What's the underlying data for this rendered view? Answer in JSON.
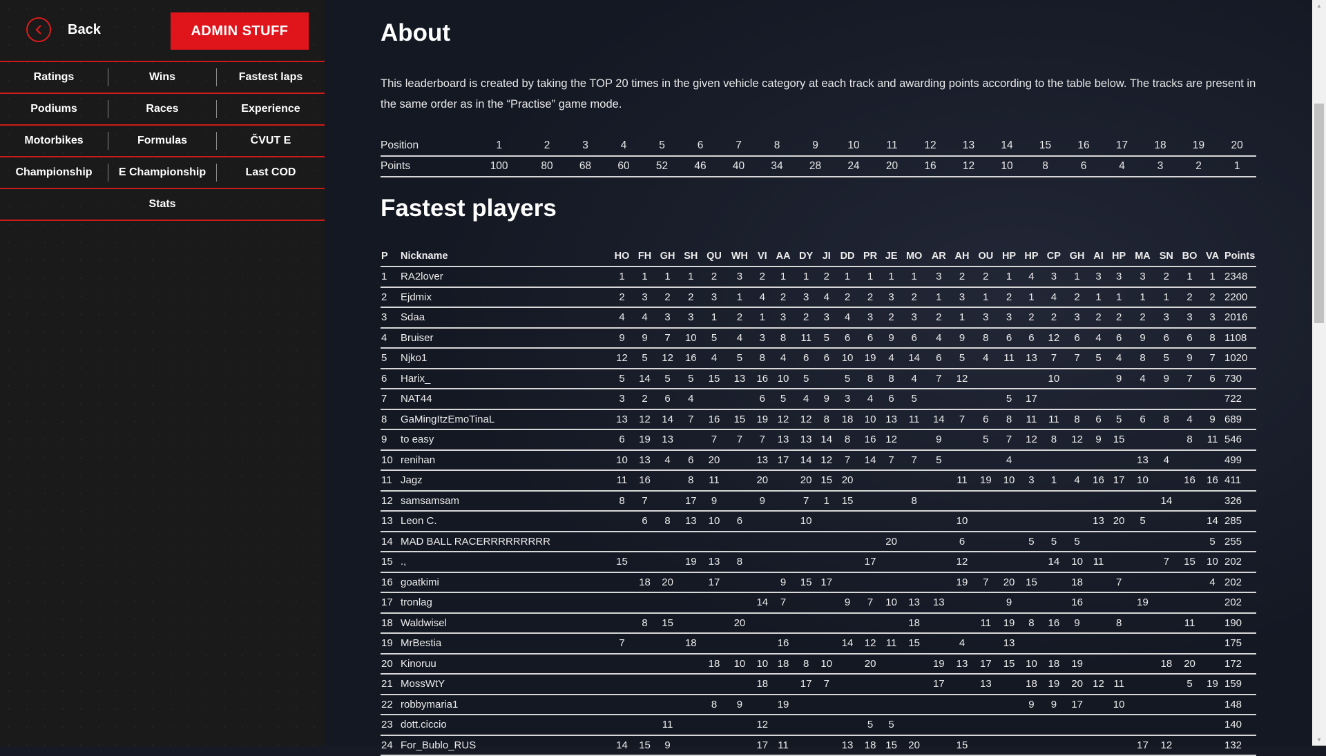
{
  "sidebar": {
    "back_label": "Back",
    "admin_label": "ADMIN STUFF",
    "nav_rows": [
      [
        "Ratings",
        "Wins",
        "Fastest laps"
      ],
      [
        "Podiums",
        "Races",
        "Experience"
      ],
      [
        "Motorbikes",
        "Formulas",
        "ČVUT E"
      ],
      [
        "Championship",
        "E Championship",
        "Last COD"
      ],
      [
        "Stats"
      ]
    ]
  },
  "about": {
    "title": "About",
    "text": "This leaderboard is created by taking the TOP 20 times in the given vehicle category at each track and awarding points according to the table below. The tracks are present in the same order as in the “Practise” game mode."
  },
  "points_table": {
    "position_label": "Position",
    "points_label": "Points",
    "positions": [
      "1",
      "2",
      "3",
      "4",
      "5",
      "6",
      "7",
      "8",
      "9",
      "10",
      "11",
      "12",
      "13",
      "14",
      "15",
      "16",
      "17",
      "18",
      "19",
      "20"
    ],
    "points": [
      "100",
      "80",
      "68",
      "60",
      "52",
      "46",
      "40",
      "34",
      "28",
      "24",
      "20",
      "16",
      "12",
      "10",
      "8",
      "6",
      "4",
      "3",
      "2",
      "1"
    ]
  },
  "players": {
    "title": "Fastest players",
    "headers": [
      "P",
      "Nickname",
      "HO",
      "FH",
      "GH",
      "SH",
      "QU",
      "WH",
      "VI",
      "AA",
      "DY",
      "JI",
      "DD",
      "PR",
      "JE",
      "MO",
      "AR",
      "AH",
      "OU",
      "HP",
      "HP",
      "CP",
      "GH",
      "AI",
      "HP",
      "MA",
      "SN",
      "BO",
      "VA",
      "Points"
    ],
    "rows": [
      [
        "1",
        "RA2lover",
        "1",
        "1",
        "1",
        "1",
        "2",
        "3",
        "2",
        "1",
        "1",
        "2",
        "1",
        "1",
        "1",
        "1",
        "3",
        "2",
        "2",
        "1",
        "4",
        "3",
        "1",
        "3",
        "3",
        "3",
        "2",
        "1",
        "1",
        "2348"
      ],
      [
        "2",
        "Ejdmix",
        "2",
        "3",
        "2",
        "2",
        "3",
        "1",
        "4",
        "2",
        "3",
        "4",
        "2",
        "2",
        "3",
        "2",
        "1",
        "3",
        "1",
        "2",
        "1",
        "4",
        "2",
        "1",
        "1",
        "1",
        "1",
        "2",
        "2",
        "2200"
      ],
      [
        "3",
        "Sdaa",
        "4",
        "4",
        "3",
        "3",
        "1",
        "2",
        "1",
        "3",
        "2",
        "3",
        "4",
        "3",
        "2",
        "3",
        "2",
        "1",
        "3",
        "3",
        "2",
        "2",
        "3",
        "2",
        "2",
        "2",
        "3",
        "3",
        "3",
        "2016"
      ],
      [
        "4",
        "Bruiser",
        "9",
        "9",
        "7",
        "10",
        "5",
        "4",
        "3",
        "8",
        "11",
        "5",
        "6",
        "6",
        "9",
        "6",
        "4",
        "9",
        "8",
        "6",
        "6",
        "12",
        "6",
        "4",
        "6",
        "9",
        "6",
        "6",
        "8",
        "1108"
      ],
      [
        "5",
        "Njko1",
        "12",
        "5",
        "12",
        "16",
        "4",
        "5",
        "8",
        "4",
        "6",
        "6",
        "10",
        "19",
        "4",
        "14",
        "6",
        "5",
        "4",
        "11",
        "13",
        "7",
        "7",
        "5",
        "4",
        "8",
        "5",
        "9",
        "7",
        "1020"
      ],
      [
        "6",
        "Harix_",
        "5",
        "14",
        "5",
        "5",
        "15",
        "13",
        "16",
        "10",
        "5",
        "",
        "5",
        "8",
        "8",
        "4",
        "7",
        "12",
        "",
        "",
        "",
        "10",
        "",
        "",
        "9",
        "4",
        "9",
        "7",
        "6",
        "730"
      ],
      [
        "7",
        "NAT44",
        "3",
        "2",
        "6",
        "4",
        "",
        "",
        "6",
        "5",
        "4",
        "9",
        "3",
        "4",
        "6",
        "5",
        "",
        "",
        "",
        "5",
        "17",
        "",
        "",
        "",
        "",
        "",
        "",
        "",
        "",
        "722"
      ],
      [
        "8",
        "GaMingItzEmoTinaL",
        "13",
        "12",
        "14",
        "7",
        "16",
        "15",
        "19",
        "12",
        "12",
        "8",
        "18",
        "10",
        "13",
        "11",
        "14",
        "7",
        "6",
        "8",
        "11",
        "11",
        "8",
        "6",
        "5",
        "6",
        "8",
        "4",
        "9",
        "689"
      ],
      [
        "9",
        "to easy",
        "6",
        "19",
        "13",
        "",
        "7",
        "7",
        "7",
        "13",
        "13",
        "14",
        "8",
        "16",
        "12",
        "",
        "9",
        "",
        "5",
        "7",
        "12",
        "8",
        "12",
        "9",
        "15",
        "",
        "",
        "8",
        "11",
        "546"
      ],
      [
        "10",
        "renihan",
        "10",
        "13",
        "4",
        "6",
        "20",
        "",
        "13",
        "17",
        "14",
        "12",
        "7",
        "14",
        "7",
        "7",
        "5",
        "",
        "",
        "4",
        "",
        "",
        "",
        "",
        "",
        "13",
        "4",
        "",
        "",
        "499"
      ],
      [
        "11",
        "Jagz",
        "11",
        "16",
        "",
        "8",
        "11",
        "",
        "20",
        "",
        "20",
        "15",
        "20",
        "",
        "",
        "",
        "",
        "11",
        "19",
        "10",
        "3",
        "1",
        "4",
        "16",
        "17",
        "10",
        "",
        "16",
        "16",
        "411"
      ],
      [
        "12",
        "samsamsam",
        "8",
        "7",
        "",
        "17",
        "9",
        "",
        "9",
        "",
        "7",
        "1",
        "15",
        "",
        "",
        "8",
        "",
        "",
        "",
        "",
        "",
        "",
        "",
        "",
        "",
        "",
        "14",
        "",
        "",
        "326"
      ],
      [
        "13",
        "Leon C.",
        "",
        "6",
        "8",
        "13",
        "10",
        "6",
        "",
        "",
        "10",
        "",
        "",
        "",
        "",
        "",
        "",
        "10",
        "",
        "",
        "",
        "",
        "",
        "13",
        "20",
        "5",
        "",
        "",
        "14",
        "285"
      ],
      [
        "14",
        "MAD BALL RACERRRRRRRRR",
        "",
        "",
        "",
        "",
        "",
        "",
        "",
        "",
        "",
        "",
        "",
        "",
        "20",
        "",
        "",
        "6",
        "",
        "",
        "5",
        "5",
        "5",
        "",
        "",
        "",
        "",
        "",
        "5",
        "255"
      ],
      [
        "15",
        ".,",
        "15",
        "",
        "",
        "19",
        "13",
        "8",
        "",
        "",
        "",
        "",
        "",
        "17",
        "",
        "",
        "",
        "12",
        "",
        "",
        "",
        "14",
        "10",
        "11",
        "",
        "",
        "7",
        "15",
        "10",
        "202"
      ],
      [
        "16",
        "goatkimi",
        "",
        "18",
        "20",
        "",
        "17",
        "",
        "",
        "9",
        "15",
        "17",
        "",
        "",
        "",
        "",
        "",
        "19",
        "7",
        "20",
        "15",
        "",
        "18",
        "",
        "7",
        "",
        "",
        "",
        "4",
        "202"
      ],
      [
        "17",
        "tronlag",
        "",
        "",
        "",
        "",
        "",
        "",
        "14",
        "7",
        "",
        "",
        "9",
        "7",
        "10",
        "13",
        "13",
        "",
        "",
        "9",
        "",
        "",
        "16",
        "",
        "",
        "19",
        "",
        "",
        "",
        "202"
      ],
      [
        "18",
        "Waldwisel",
        "",
        "8",
        "15",
        "",
        "",
        "20",
        "",
        "",
        "",
        "",
        "",
        "",
        "",
        "18",
        "",
        "",
        "11",
        "19",
        "8",
        "16",
        "9",
        "",
        "8",
        "",
        "",
        "11",
        "",
        "190"
      ],
      [
        "19",
        "MrBestia",
        "7",
        "",
        "",
        "18",
        "",
        "",
        "",
        "16",
        "",
        "",
        "14",
        "12",
        "11",
        "15",
        "",
        "4",
        "",
        "13",
        "",
        "",
        "",
        "",
        "",
        "",
        "",
        "",
        "",
        "175"
      ],
      [
        "20",
        "Kinoruu",
        "",
        "",
        "",
        "",
        "18",
        "10",
        "10",
        "18",
        "8",
        "10",
        "",
        "20",
        "",
        "",
        "19",
        "13",
        "17",
        "15",
        "10",
        "18",
        "19",
        "",
        "",
        "",
        "18",
        "20",
        "",
        "172"
      ],
      [
        "21",
        "MossWtY",
        "",
        "",
        "",
        "",
        "",
        "",
        "18",
        "",
        "17",
        "7",
        "",
        "",
        "",
        "",
        "17",
        "",
        "13",
        "",
        "18",
        "19",
        "20",
        "12",
        "11",
        "",
        "",
        "5",
        "19",
        "159"
      ],
      [
        "22",
        "robbymaria1",
        "",
        "",
        "",
        "",
        "8",
        "9",
        "",
        "19",
        "",
        "",
        "",
        "",
        "",
        "",
        "",
        "",
        "",
        "",
        "9",
        "9",
        "17",
        "",
        "10",
        "",
        "",
        "",
        "",
        "148"
      ],
      [
        "23",
        "dott.ciccio",
        "",
        "",
        "11",
        "",
        "",
        "",
        "12",
        "",
        "",
        "",
        "",
        "5",
        "5",
        "",
        "",
        "",
        "",
        "",
        "",
        "",
        "",
        "",
        "",
        "",
        "",
        "",
        "",
        "140"
      ],
      [
        "24",
        "For_Bublo_RUS",
        "14",
        "15",
        "9",
        "",
        "",
        "",
        "17",
        "11",
        "",
        "",
        "13",
        "18",
        "15",
        "20",
        "",
        "15",
        "",
        "",
        "",
        "",
        "",
        "",
        "",
        "17",
        "12",
        "",
        "",
        "132"
      ]
    ]
  }
}
